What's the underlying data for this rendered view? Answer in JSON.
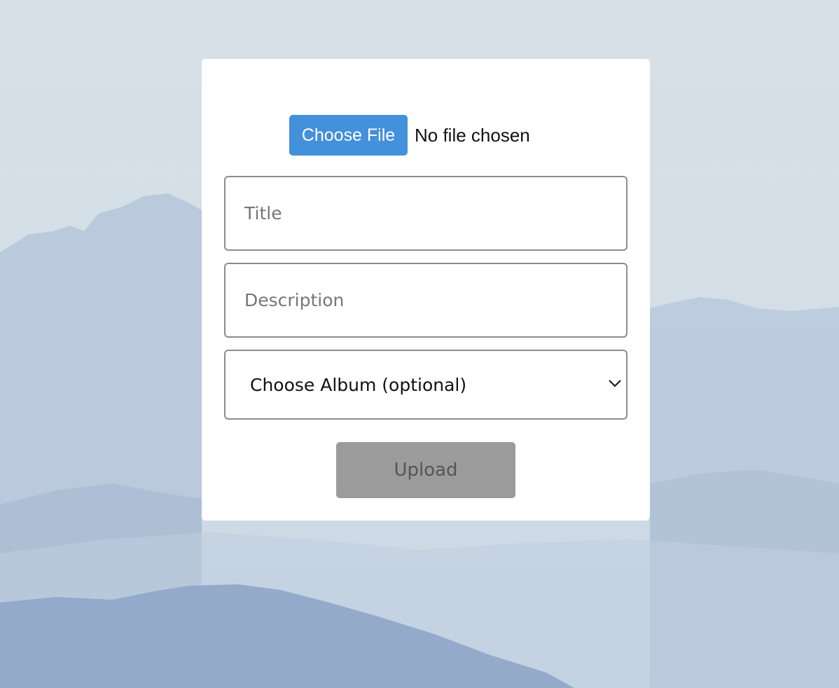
{
  "upload_form": {
    "file_button_label": "Choose File",
    "file_status": "No file chosen",
    "title_placeholder": "Title",
    "description_placeholder": "Description",
    "album_select_value": "Choose Album (optional)",
    "upload_label": "Upload"
  },
  "icons": {
    "album_dropdown": "chevron-down-icon"
  },
  "colors": {
    "file_button": "#4390db",
    "upload_button_disabled": "#9b9b9b",
    "card_background": "#ffffff"
  }
}
